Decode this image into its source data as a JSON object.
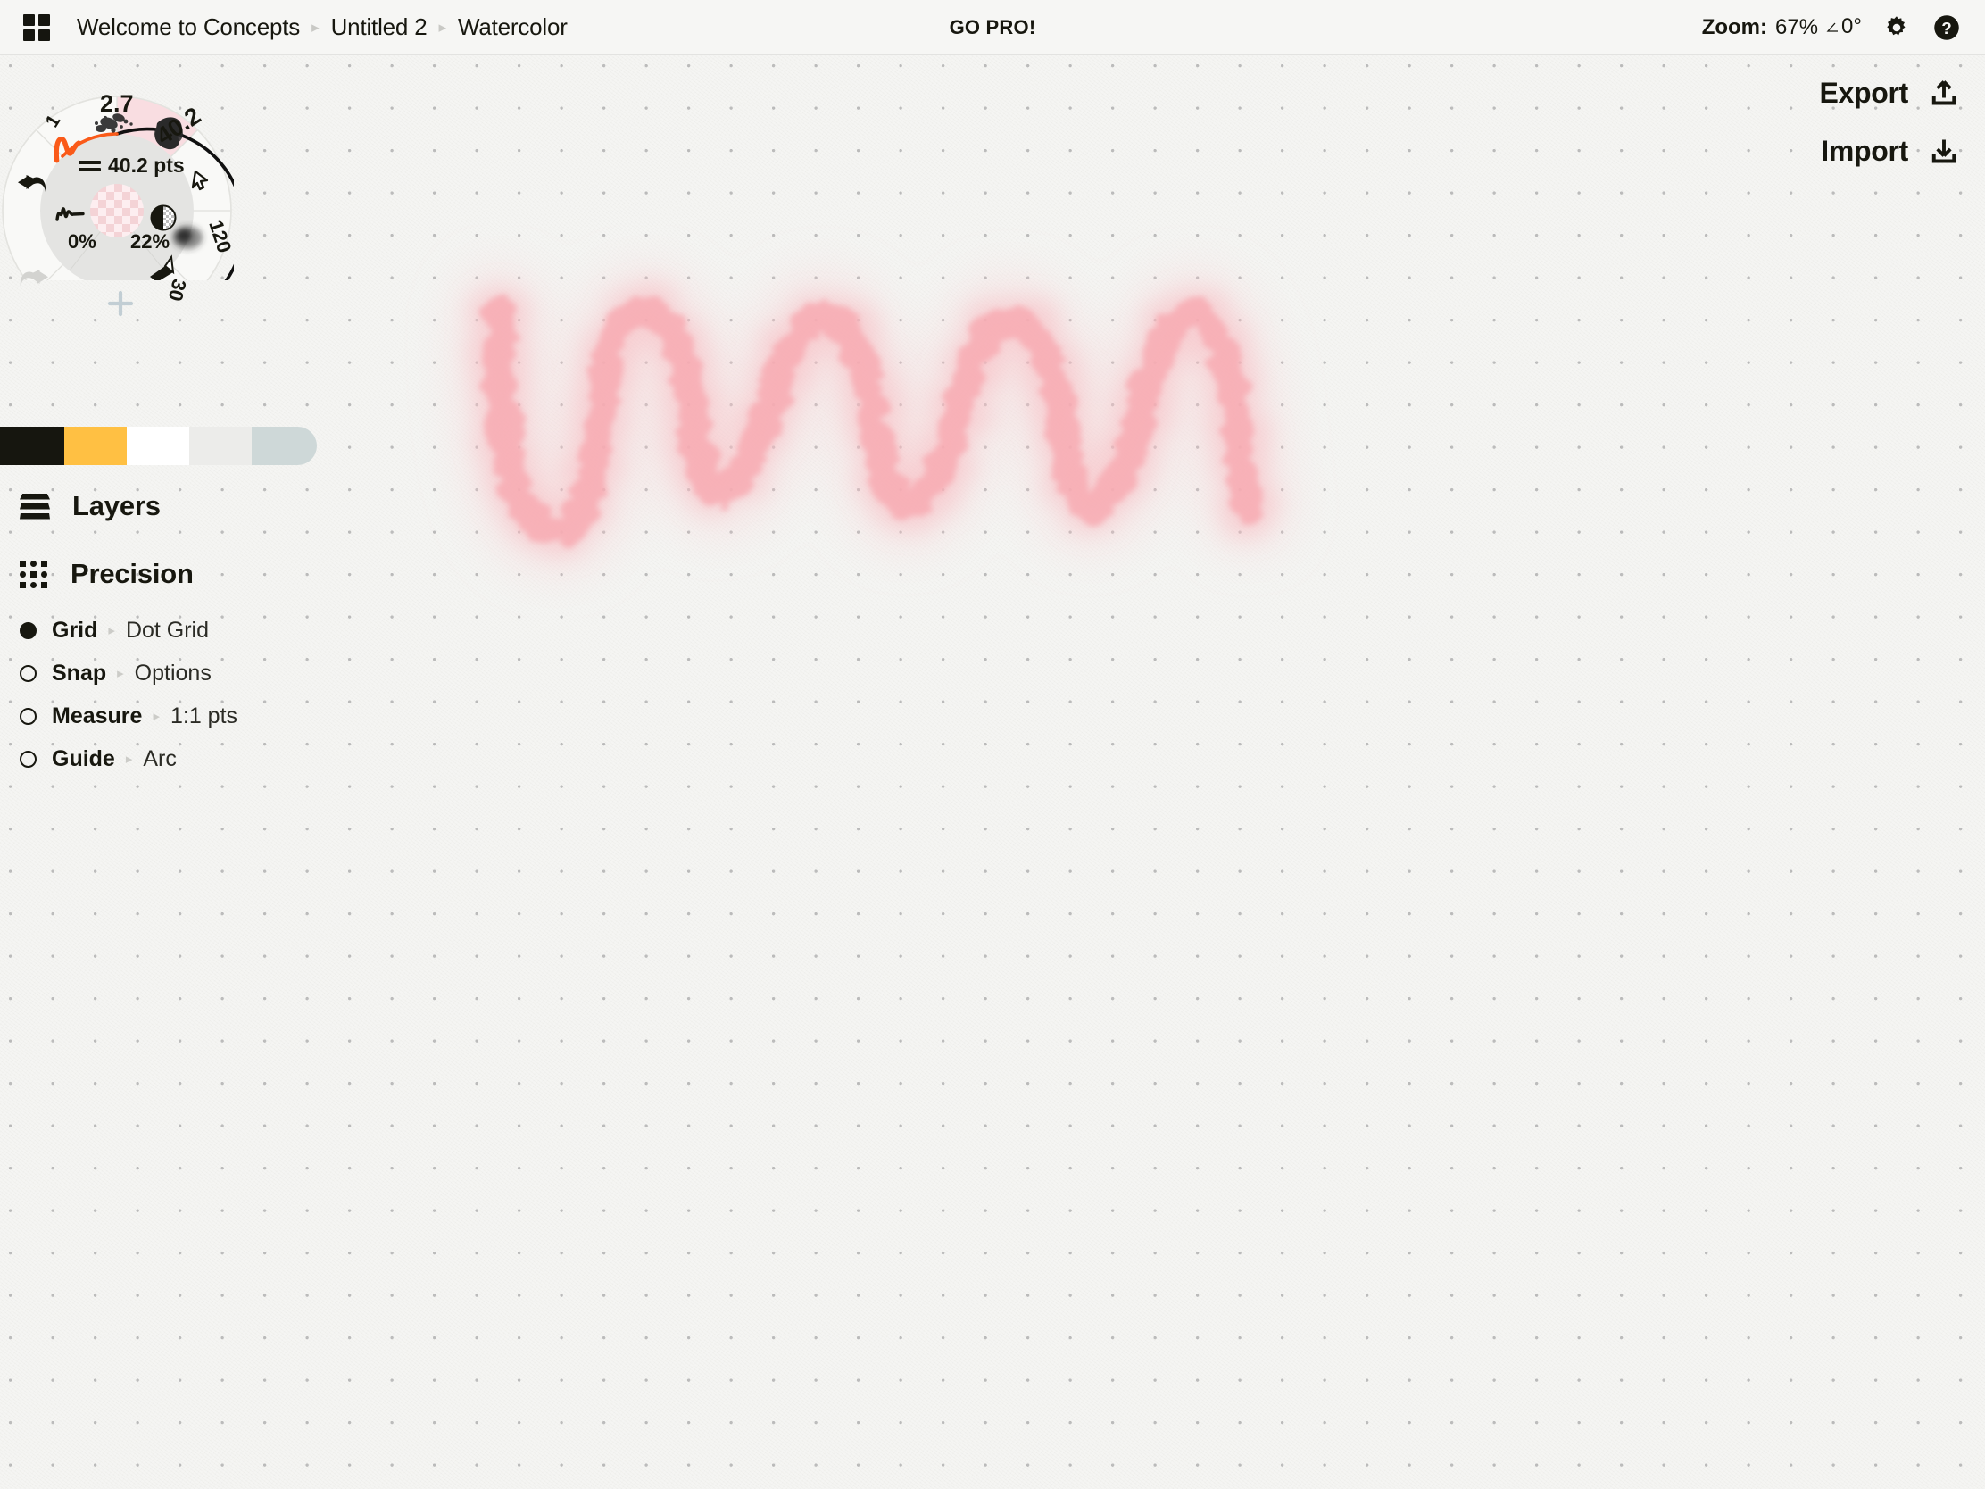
{
  "app": {
    "background_color": "#f5f5f3",
    "accent_pink": "#f7b8bd",
    "menu_icon": "grid-menu-icon"
  },
  "topbar": {
    "breadcrumb": [
      "Welcome to Concepts",
      "Untitled 2",
      "Watercolor"
    ],
    "breadcrumb_separator": "▸",
    "go_pro": "GO PRO!",
    "zoom_label": "Zoom:",
    "zoom_value": "67%",
    "rotation_value": "0°",
    "settings_icon": "gear-icon",
    "help_icon": "help-circle-icon"
  },
  "io": {
    "export_label": "Export",
    "export_icon": "upload-tray-icon",
    "import_label": "Import",
    "import_icon": "download-tray-icon"
  },
  "history": {
    "undo_icon": "undo-arrow-icon",
    "undo_enabled": true,
    "redo_icon": "redo-arrow-icon",
    "redo_enabled": false
  },
  "tool_wheel": {
    "hub": {
      "size_value": "40.2 pts",
      "size_icon": "stroke-weight-icon",
      "smoothing_icon": "smoothing-wave-icon",
      "smoothing_value": "0%",
      "opacity_icon": "opacity-half-circle-icon",
      "opacity_value": "22%",
      "color_swatch": "transparent-checker-swatch"
    },
    "segments": [
      {
        "label": "1",
        "name": "brush-pen",
        "selected": false
      },
      {
        "label": "2.7",
        "name": "brush-dry-media",
        "selected": false
      },
      {
        "label": "40.2",
        "name": "brush-watercolor",
        "selected": true
      },
      {
        "label": "",
        "name": "tool-selection",
        "selected": false
      },
      {
        "label": "120",
        "name": "brush-airbrush",
        "selected": false
      },
      {
        "label": "30",
        "name": "brush-fill",
        "selected": false
      },
      {
        "label": "+",
        "name": "add-tool",
        "selected": false
      }
    ],
    "selected_color": "#f9dfe2"
  },
  "palette": {
    "swatches": [
      {
        "name": "swatch-black",
        "color": "#16160f"
      },
      {
        "name": "swatch-amber",
        "color": "#ffc043"
      },
      {
        "name": "swatch-white",
        "color": "#ffffff"
      },
      {
        "name": "swatch-lightgray",
        "color": "#ececea"
      },
      {
        "name": "swatch-bluegray",
        "color": "#ced8d8"
      }
    ]
  },
  "left_panel": {
    "layers": {
      "label": "Layers",
      "icon": "layers-stack-icon"
    },
    "precision": {
      "label": "Precision",
      "icon": "precision-dots-icon"
    },
    "precision_rows": [
      {
        "name": "Grid",
        "arrow": "▸",
        "value": "Dot Grid",
        "active": true
      },
      {
        "name": "Snap",
        "arrow": "▸",
        "value": "Options",
        "active": false
      },
      {
        "name": "Measure",
        "arrow": "▸",
        "value": "1:1 pts",
        "active": false
      },
      {
        "name": "Guide",
        "arrow": "▸",
        "value": "Arc",
        "active": false
      }
    ]
  },
  "artwork": {
    "description": "pink watercolor zigzag wave stroke",
    "stroke_color": "#f8aeb4"
  }
}
